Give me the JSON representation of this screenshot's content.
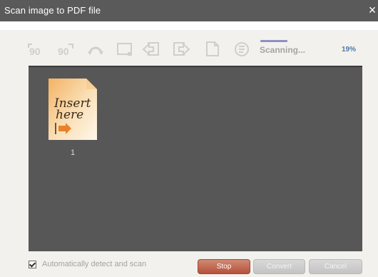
{
  "window": {
    "title": "Scan image to PDF file",
    "close_glyph": "×"
  },
  "toolbar": {
    "icons": [
      "rotate-ccw-90-icon",
      "rotate-cw-90-icon",
      "rotate-180-icon",
      "crop-icon",
      "move-left-icon",
      "move-right-icon",
      "page-icon",
      "settings-icon"
    ],
    "status_text": "Scanning...",
    "progress_percent": "19%",
    "progress_value": 0.19
  },
  "workarea": {
    "thumbnails": [
      {
        "number": "1",
        "image_text": "Insert here"
      }
    ]
  },
  "footer": {
    "auto_detect_label": "Automatically detect and scan",
    "auto_detect_checked": true,
    "stop_label": "Stop",
    "convert_label": "Convert",
    "cancel_label": "Cancel"
  },
  "colors": {
    "titlebar": "#5a5a5a",
    "workarea": "#575757",
    "stop_button": "#c0604a",
    "percent": "#4d7aa6"
  }
}
